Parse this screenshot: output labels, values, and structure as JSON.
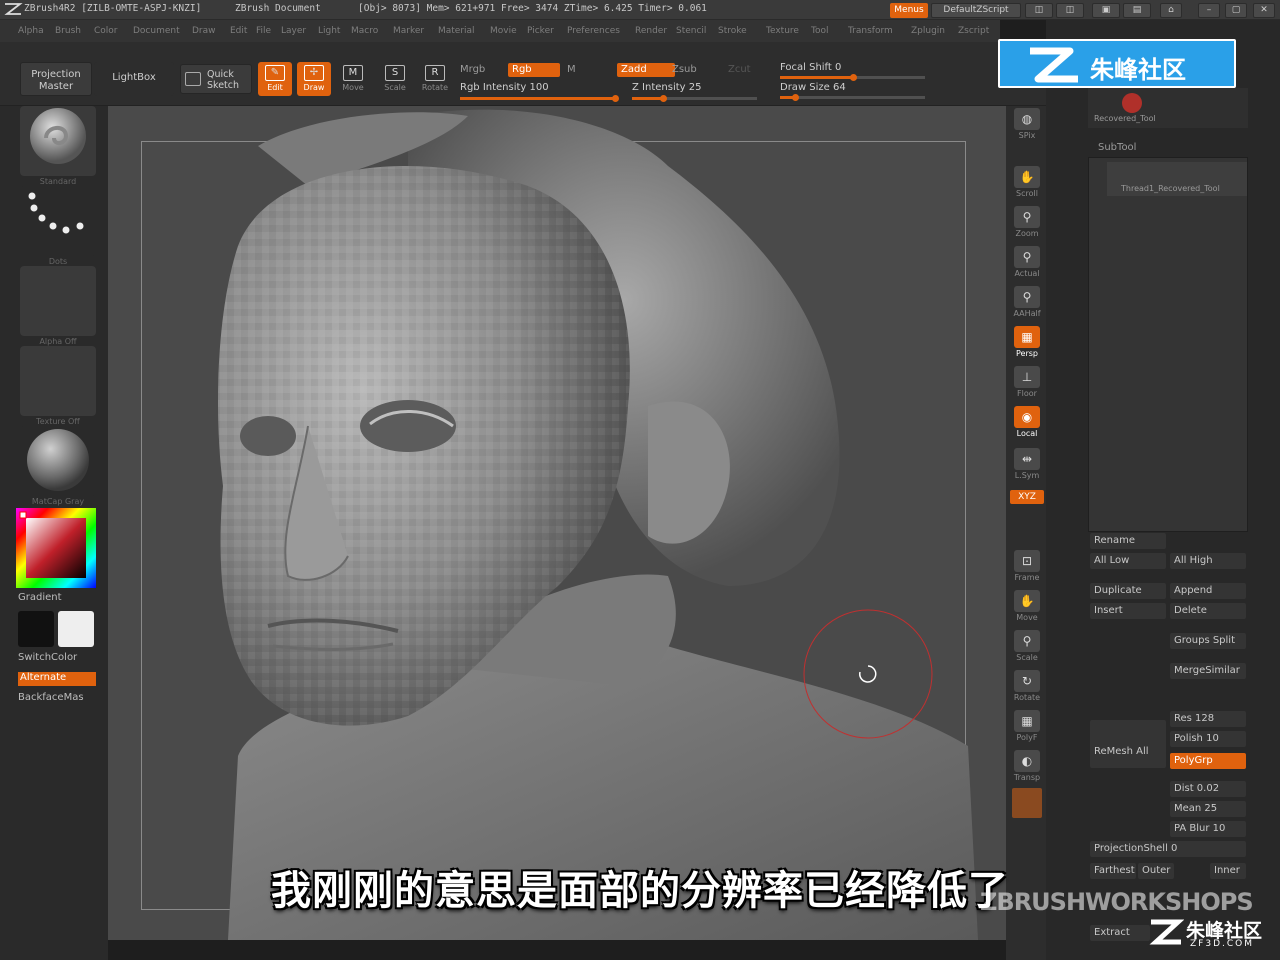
{
  "titlebar": {
    "app": "ZBrush4R2 [ZILB-OMTE-ASPJ-KNZI]",
    "document": "ZBrush Document",
    "stats": "[Obj> 8073] Mem> 621+971  Free> 3474  ZTime> 6.425  Timer> 0.061",
    "menus_label": "Menus",
    "script_label": "DefaultZScript"
  },
  "menubar": [
    "Alpha",
    "Brush",
    "Color",
    "Document",
    "Draw",
    "Edit",
    "File",
    "Layer",
    "Light",
    "Macro",
    "Marker",
    "Material",
    "Movie",
    "Picker",
    "Preferences",
    "Render",
    "Stencil",
    "Stroke",
    "Texture",
    "Tool",
    "Transform",
    "Zplugin",
    "Zscript"
  ],
  "shelf": {
    "projection_master": "Projection Master",
    "lightbox": "LightBox",
    "quick_sketch": "Quick Sketch",
    "tools": [
      {
        "label": "Edit",
        "icon": "edit-icon",
        "glyph": "✎",
        "on": true
      },
      {
        "label": "Draw",
        "icon": "draw-icon",
        "glyph": "✢",
        "on": true
      },
      {
        "label": "Move",
        "icon": "move-icon",
        "glyph": "M",
        "on": false
      },
      {
        "label": "Scale",
        "icon": "scale-icon",
        "glyph": "S",
        "on": false
      },
      {
        "label": "Rotate",
        "icon": "rotate-icon",
        "glyph": "R",
        "on": false
      }
    ],
    "mrgb": "Mrgb",
    "rgb": "Rgb",
    "m": "M",
    "rgb_intensity": "Rgb Intensity 100",
    "zadd": "Zadd",
    "zsub": "Zsub",
    "zcut": "Zcut",
    "z_intensity": "Z Intensity 25",
    "focal_shift": "Focal Shift 0",
    "draw_size": "Draw Size 64",
    "rgb_intensity_level": 1.0,
    "z_intensity_level": 0.25,
    "focal_shift_level": 0.5,
    "draw_size_level": 0.1
  },
  "leftshelf": {
    "thumbs": [
      "Standard",
      "Dots",
      "Alpha Off",
      "Texture Off",
      "MatCap Gray"
    ],
    "gradient": "Gradient",
    "switchcolor": "SwitchColor",
    "alternate": "Alternate",
    "backfacemask": "BackfaceMas"
  },
  "rightshelf": [
    {
      "label": "SPix",
      "icon": "spix-icon",
      "glyph": "◍",
      "on": false
    },
    {
      "label": "Scroll",
      "icon": "hand-scroll-icon",
      "glyph": "✋",
      "on": false
    },
    {
      "label": "Zoom",
      "icon": "zoom-icon",
      "glyph": "⚲",
      "on": false
    },
    {
      "label": "Actual",
      "icon": "actual-icon",
      "glyph": "⚲",
      "on": false
    },
    {
      "label": "AAHalf",
      "icon": "aahalf-icon",
      "glyph": "⚲",
      "on": false
    },
    {
      "label": "Persp",
      "icon": "persp-icon",
      "glyph": "▦",
      "on": true
    },
    {
      "label": "Floor",
      "icon": "floor-icon",
      "glyph": "⊥",
      "on": false
    },
    {
      "label": "Local",
      "icon": "local-icon",
      "glyph": "◉",
      "on": true
    },
    {
      "label": "L.Sym",
      "icon": "lsym-icon",
      "glyph": "⇹",
      "on": false
    },
    {
      "label": "Frame",
      "icon": "frame-icon",
      "glyph": "⊡",
      "on": false
    },
    {
      "label": "Move",
      "icon": "move-hand-icon",
      "glyph": "✋",
      "on": false
    },
    {
      "label": "Scale",
      "icon": "scale-view-icon",
      "glyph": "⚲",
      "on": false
    },
    {
      "label": "Rotate",
      "icon": "rotate-view-icon",
      "glyph": "↻",
      "on": false
    },
    {
      "label": "PolyF",
      "icon": "polyframe-icon",
      "glyph": "▦",
      "on": false
    },
    {
      "label": "Transp",
      "icon": "transp-icon",
      "glyph": "◐",
      "on": false
    }
  ],
  "rightshelf_xyz": "XYZ",
  "tray": {
    "recovered_tool": "Recovered_Tool",
    "subtool_header": "SubTool",
    "subtool_item": "Thread1_Recovered_Tool",
    "rename": "Rename",
    "all_low": "All Low",
    "all_high": "All High",
    "duplicate": "Duplicate",
    "append": "Append",
    "insert": "Insert",
    "delete": "Delete",
    "groups_split": "Groups Split",
    "merge_similar": "MergeSimilar",
    "remesh_all": "ReMesh All",
    "res": "Res 128",
    "polish": "Polish 10",
    "polygrp": "PolyGrp",
    "dist": "Dist 0.02",
    "mean": "Mean 25",
    "pa_blur": "PA Blur 10",
    "projection_shell": "ProjectionShell 0",
    "farthest": "Farthest",
    "outer": "Outer",
    "inner": "Inner",
    "extract": "Extract"
  },
  "watermark": "朱峰社区",
  "subtitle": "我刚刚的意思是面部的分辨率已经降低了",
  "zbrush_workshops": "ZBRUSHWORKSHOPS",
  "zf3d": {
    "name": "朱峰社区",
    "url": "ZF3D.COM"
  },
  "colors": {
    "accent": "#e0620e",
    "watermark_blue": "#2aa0e8",
    "viewport_bg": "#4a4a4a"
  }
}
